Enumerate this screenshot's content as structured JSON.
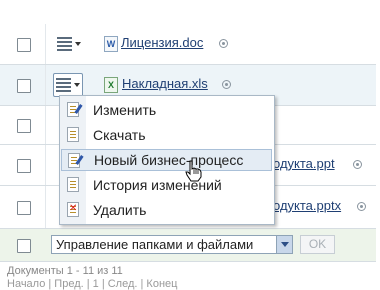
{
  "files": [
    {
      "name": "Лицензия.doc",
      "type": "word"
    },
    {
      "name": "Накладная.xls",
      "type": "excel"
    },
    {
      "name": "одукта.ppt",
      "type": "ppt"
    },
    {
      "name": "одукта.pptx",
      "type": "ppt"
    }
  ],
  "context_menu": {
    "items": [
      {
        "label": "Изменить",
        "icon": "edit-icon"
      },
      {
        "label": "Скачать",
        "icon": "download-icon"
      },
      {
        "label": "Новый бизнес-процесс",
        "icon": "business-process-icon"
      },
      {
        "label": "История изменений",
        "icon": "history-icon"
      },
      {
        "label": "Удалить",
        "icon": "delete-icon"
      }
    ]
  },
  "footer": {
    "action_select": "Управление папками и файлами",
    "ok_label": "OK"
  },
  "status": "Документы 1 - 11 из 11",
  "pager": "Начало | Пред. | 1 | След. | Конец"
}
